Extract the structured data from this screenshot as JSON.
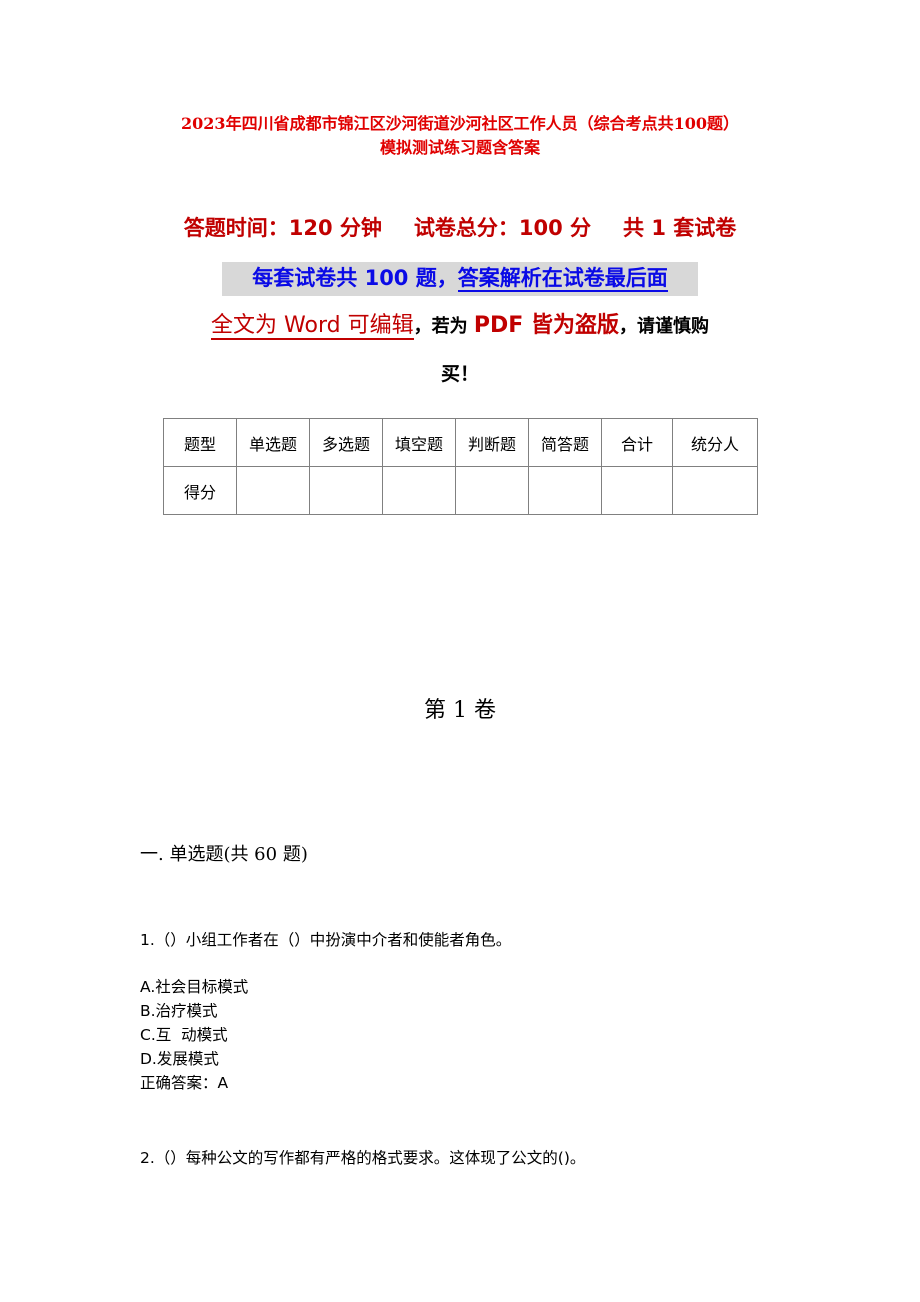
{
  "document": {
    "title_line1": "2023年四川省成都市锦江区沙河街道沙河社区工作人员（综合考点共100题）",
    "title_line2": "模拟测试练习题含答案",
    "exam_info": {
      "time": "答题时间：120 分钟",
      "total_score": "试卷总分：100 分",
      "sets": "共 1 套试卷"
    },
    "notice_blue": {
      "part1": "每套试卷共 100 题，",
      "part2": "答案解析在试卷最后面"
    },
    "notice_word": {
      "part1": "全文为 Word 可编辑",
      "comma1": "，",
      "part2": "若为 ",
      "part3": "PDF 皆为盗版",
      "part4": "，请谨慎购",
      "part5": "买！"
    },
    "score_table": {
      "header": [
        "题型",
        "单选题",
        "多选题",
        "填空题",
        "判断题",
        "简答题",
        "合计",
        "统分人"
      ],
      "row": [
        "得分",
        "",
        "",
        "",
        "",
        "",
        "",
        ""
      ]
    },
    "volume_title": "第 1 卷",
    "section_title": "一. 单选题(共 60 题)",
    "questions": [
      {
        "text": "1.（）小组工作者在（）中扮演中介者和使能者角色。",
        "options": [
          "A.社会目标模式",
          "B.治疗模式",
          "C.互  动模式",
          "D.发展模式"
        ],
        "answer": "正确答案：A"
      },
      {
        "text": "2.（）每种公文的写作都有严格的格式要求。这体现了公文的()。"
      }
    ]
  }
}
